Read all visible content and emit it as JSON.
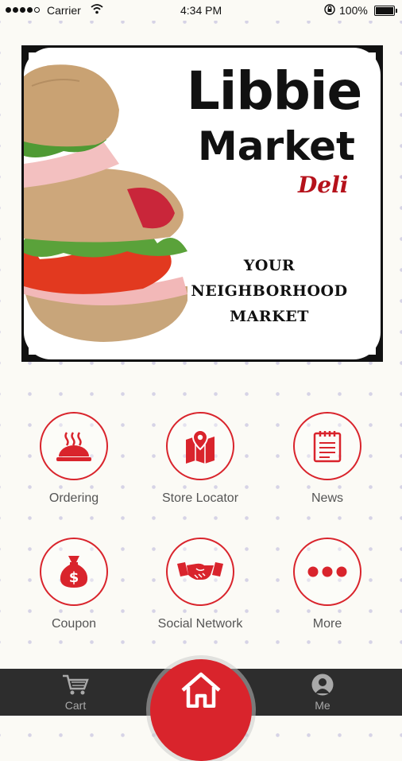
{
  "status_bar": {
    "carrier": "Carrier",
    "time": "4:34 PM",
    "battery": "100%"
  },
  "banner": {
    "title_line1": "Libbie",
    "title_line2": "Market",
    "title_line3": "Deli",
    "tagline": [
      "YOUR",
      "NEIGHBORHOOD",
      "MARKET"
    ]
  },
  "tiles": [
    {
      "label": "Ordering",
      "icon": "cloche-icon"
    },
    {
      "label": "Store Locator",
      "icon": "map-pin-icon"
    },
    {
      "label": "News",
      "icon": "notepad-icon"
    },
    {
      "label": "Coupon",
      "icon": "money-bag-icon"
    },
    {
      "label": "Social Network",
      "icon": "handshake-icon"
    },
    {
      "label": "More",
      "icon": "more-dots-icon"
    }
  ],
  "tab_bar": {
    "cart_label": "Cart",
    "me_label": "Me"
  },
  "colors": {
    "accent": "#d9242c",
    "tab_bar": "#2d2d2d",
    "background": "#fbfaf5"
  }
}
